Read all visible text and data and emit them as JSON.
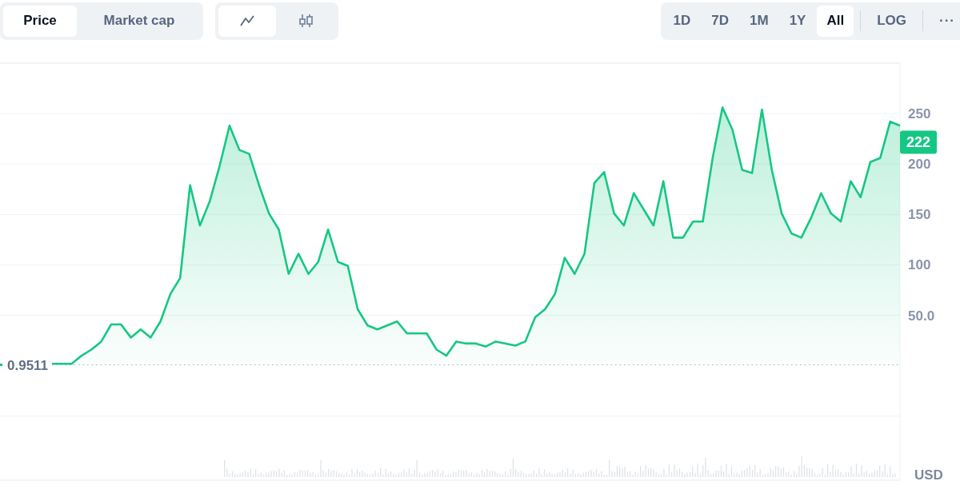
{
  "metric_tabs": [
    {
      "label": "Price",
      "selected": true
    },
    {
      "label": "Market cap",
      "selected": false
    }
  ],
  "chart_types": [
    {
      "kind": "line",
      "selected": true
    },
    {
      "kind": "candle",
      "selected": false
    }
  ],
  "ranges": [
    {
      "label": "1D",
      "selected": false
    },
    {
      "label": "7D",
      "selected": false
    },
    {
      "label": "1M",
      "selected": false
    },
    {
      "label": "1Y",
      "selected": false
    },
    {
      "label": "All",
      "selected": true
    }
  ],
  "log_button": "LOG",
  "more_button": "···",
  "chart": {
    "current_price": "222",
    "currency": "USD",
    "chart_data": {
      "type": "area",
      "grid": true,
      "ylim": [
        -113.5,
        300
      ],
      "ref_lines": [
        {
          "axis": "y",
          "value": 0.9511,
          "label": "0.9511"
        }
      ],
      "yticks": [
        {
          "value": 50,
          "label": "50.0"
        },
        100,
        150,
        200,
        250
      ],
      "series": [
        {
          "color": "#16c784",
          "values": [
            2,
            2,
            2,
            10,
            16,
            24,
            41,
            41,
            28,
            36,
            28,
            44,
            71,
            87,
            179,
            139,
            163,
            198,
            238,
            214,
            210,
            179,
            151,
            135,
            91,
            111,
            91,
            103,
            135,
            103,
            99,
            56,
            40,
            36,
            40,
            44,
            32,
            32,
            32,
            16,
            10,
            24,
            22,
            22,
            19,
            24,
            22,
            20,
            24,
            48,
            56,
            71,
            107,
            91,
            111,
            181,
            192,
            151,
            139,
            171,
            155,
            139,
            183,
            127,
            127,
            143,
            143,
            206,
            256,
            234,
            194,
            191,
            254,
            194,
            151,
            131,
            127,
            147,
            171,
            151,
            143,
            183,
            167,
            202,
            206,
            242,
            238
          ]
        }
      ]
    }
  }
}
